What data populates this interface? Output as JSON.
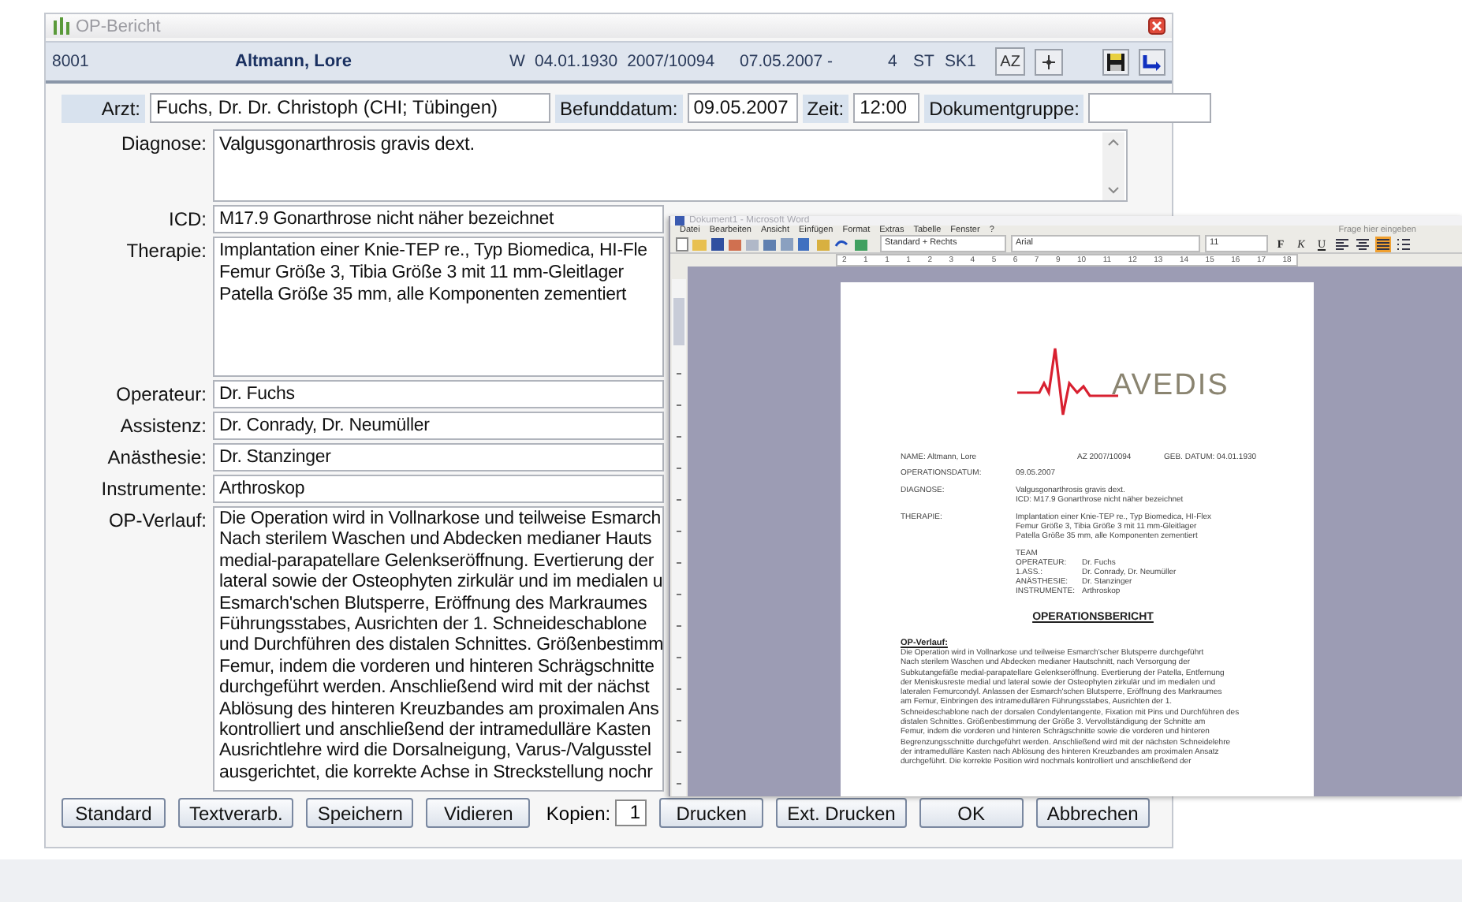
{
  "window": {
    "title": "OP-Bericht"
  },
  "header": {
    "case_no": "8001",
    "patient": "Altmann, Lore",
    "sex": "W",
    "birth_date": "04.01.1930",
    "file_no": "2007/10094",
    "period": "07.05.2007 -",
    "column_8": "4",
    "column_9": "ST",
    "column_10": "SK1",
    "sort_button": "AZ"
  },
  "top_fields": [
    {
      "label": "Arzt:",
      "value": "Fuchs, Dr. Dr. Christoph (CHI; Tübingen)",
      "kind": "doctor"
    },
    {
      "label": "Befunddatum:",
      "value": "09.05.2007",
      "kind": "date"
    },
    {
      "label": "Zeit:",
      "value": "12:00",
      "kind": "time"
    },
    {
      "label": "Dokumentgruppe:",
      "kind": "group"
    }
  ],
  "fields": [
    {
      "label": "Diagnose:",
      "kind": "short_memo",
      "lines": [
        "Valgusgonarthrosis gravis dext."
      ]
    },
    {
      "label": "ICD:",
      "kind": "line",
      "lines": [
        "M17.9 Gonarthrose nicht näher bezeichnet"
      ]
    },
    {
      "label": "Therapie:",
      "kind": "memo",
      "lines": [
        "Implantation einer Knie-TEP re., Typ Biomedica, HI-Fle",
        "Femur Größe 3, Tibia Größe 3 mit 11 mm-Gleitlager",
        "Patella Größe 35 mm, alle Komponenten zementiert"
      ]
    },
    {
      "label": "Operateur:",
      "kind": "line",
      "lines": [
        "Dr. Fuchs"
      ]
    },
    {
      "label": "Assistenz:",
      "kind": "line",
      "lines": [
        "Dr. Conrady, Dr. Neumüller"
      ]
    },
    {
      "label": "Anästhesie:",
      "kind": "line",
      "lines": [
        "Dr. Stanzinger"
      ]
    },
    {
      "label": "Instrumente:",
      "kind": "line",
      "lines": [
        "Arthroskop"
      ]
    },
    {
      "label": "OP-Verlauf:",
      "kind": "long_memo",
      "lines": [
        "Die Operation wird in Vollnarkose und teilweise Esmarch",
        "Nach sterilem Waschen und Abdecken medianer Hauts",
        "medial-parapatellare Gelenkseröffnung. Evertierung der",
        "lateral sowie der Osteophyten zirkulär und im medialen u",
        "Esmarch'schen Blutsperre, Eröffnung des Markraumes",
        "Führungsstabes, Ausrichten der 1. Schneideschablone",
        "und Durchführen des distalen Schnittes. Größenbestimm",
        "Femur, indem die vorderen und hinteren Schrägschnitte",
        "durchgeführt werden. Anschließend wird mit der nächst",
        "Ablösung des hinteren Kreuzbandes am proximalen Ans",
        "kontrolliert und anschließend der intramedulläre Kasten",
        "Ausrichtlehre wird die Dorsalneigung, Varus-/Valgusstel",
        "ausgerichtet, die korrekte Achse in Streckstellung nochr"
      ]
    }
  ],
  "buttons": [
    {
      "label": "Standard"
    },
    {
      "label": "Textverarb."
    },
    {
      "label": "Speichern"
    },
    {
      "label": "Vidieren"
    }
  ],
  "copies": {
    "label": "Kopien:",
    "value": "1"
  },
  "covered_buttons": [
    {
      "label": "Drucken"
    },
    {
      "label": "Ext. Drucken"
    },
    {
      "label": "OK"
    },
    {
      "label": "Abbrechen"
    }
  ],
  "word": {
    "title": "Dokument1 - Microsoft Word",
    "menu": [
      "Datei",
      "Bearbeiten",
      "Ansicht",
      "Einfügen",
      "Format",
      "Extras",
      "Tabelle",
      "Fenster",
      "?"
    ],
    "help_placeholder": "Frage hier eingeben",
    "style": "Standard + Rechts",
    "font": "Arial",
    "size": "11",
    "format_buttons": [
      {
        "label": "F",
        "kind": "bold"
      },
      {
        "label": "K",
        "kind": "italic"
      },
      {
        "label": "U",
        "kind": "underline"
      }
    ],
    "align_buttons": [
      {
        "kind": "left",
        "selected": false
      },
      {
        "kind": "center",
        "selected": false
      },
      {
        "kind": "justify",
        "selected": true
      }
    ],
    "ruler": [
      "2",
      "1",
      "1",
      "1",
      "2",
      "3",
      "4",
      "5",
      "6",
      "7",
      "9",
      "10",
      "11",
      "12",
      "13",
      "14",
      "15",
      "16",
      "17",
      "18"
    ],
    "doc": {
      "logo": "AVEDIS",
      "name": "NAME: Altmann, Lore",
      "az": "AZ 2007/10094",
      "birth": "GEB. DATUM: 04.01.1930",
      "sections": [
        {
          "label": "OPERATIONSDATUM:",
          "lines": [
            "09.05.2007"
          ]
        },
        {
          "label": "DIAGNOSE:",
          "lines": [
            "Valgusgonarthrosis gravis dext.",
            "ICD: M17.9 Gonarthrose nicht näher bezeichnet"
          ]
        },
        {
          "label": "THERAPIE:",
          "lines": [
            "Implantation einer Knie-TEP re., Typ Biomedica, HI-Flex",
            "Femur Größe 3, Tibia Größe 3 mit 11 mm-Gleitlager",
            "Patella Größe 35 mm, alle Komponenten zementiert"
          ]
        }
      ],
      "team_title": "TEAM",
      "team": [
        {
          "role": "OPERATEUR:",
          "name": "Dr. Fuchs"
        },
        {
          "role": "1.ASS.:",
          "name": "Dr. Conrady, Dr. Neumüller"
        },
        {
          "role": "ANÄSTHESIE:",
          "name": "Dr. Stanzinger"
        },
        {
          "role": "INSTRUMENTE:",
          "name": "Arthroskop"
        }
      ],
      "heading": "OPERATIONSBERICHT",
      "subheading": "OP-Verlauf:",
      "paragraph": [
        "Die Operation wird in Vollnarkose und teilweise Esmarch'scher Blutsperre durchgeführt",
        "Nach sterilem Waschen und Abdecken medianer Hautschnitt, nach Versorgung der",
        "Subkutangefäße medial-parapatellare Gelenkseröffnung. Evertierung der Patella, Entfernung",
        "der Meniskusreste medial und lateral sowie der Osteophyten zirkulär und im medialen und",
        "lateralen Femurcondyl. Anlassen der Esmarch'schen Blutsperre, Eröffnung des Markraumes",
        "am Femur, Einbringen des intramedullären Führungsstabes, Ausrichten der 1.",
        "Schneideschablone nach der dorsalen Condylentangente, Fixation mit Pins und Durchführen des",
        "distalen Schnittes. Größenbestimmung der Größe 3. Vervollständigung der Schnitte am",
        "Femur, indem die vorderen und hinteren Schrägschnitte sowie die vorderen und hinteren",
        "Begrenzungsschnitte durchgeführt werden. Anschließend wird mit der nächsten Schneidelehre",
        "der intramedulläre Kasten nach Ablösung des hinteren Kreuzbandes am proximalen Ansatz",
        "durchgeführt. Die korrekte Position wird nochmals kontrolliert und anschließend der"
      ]
    }
  }
}
